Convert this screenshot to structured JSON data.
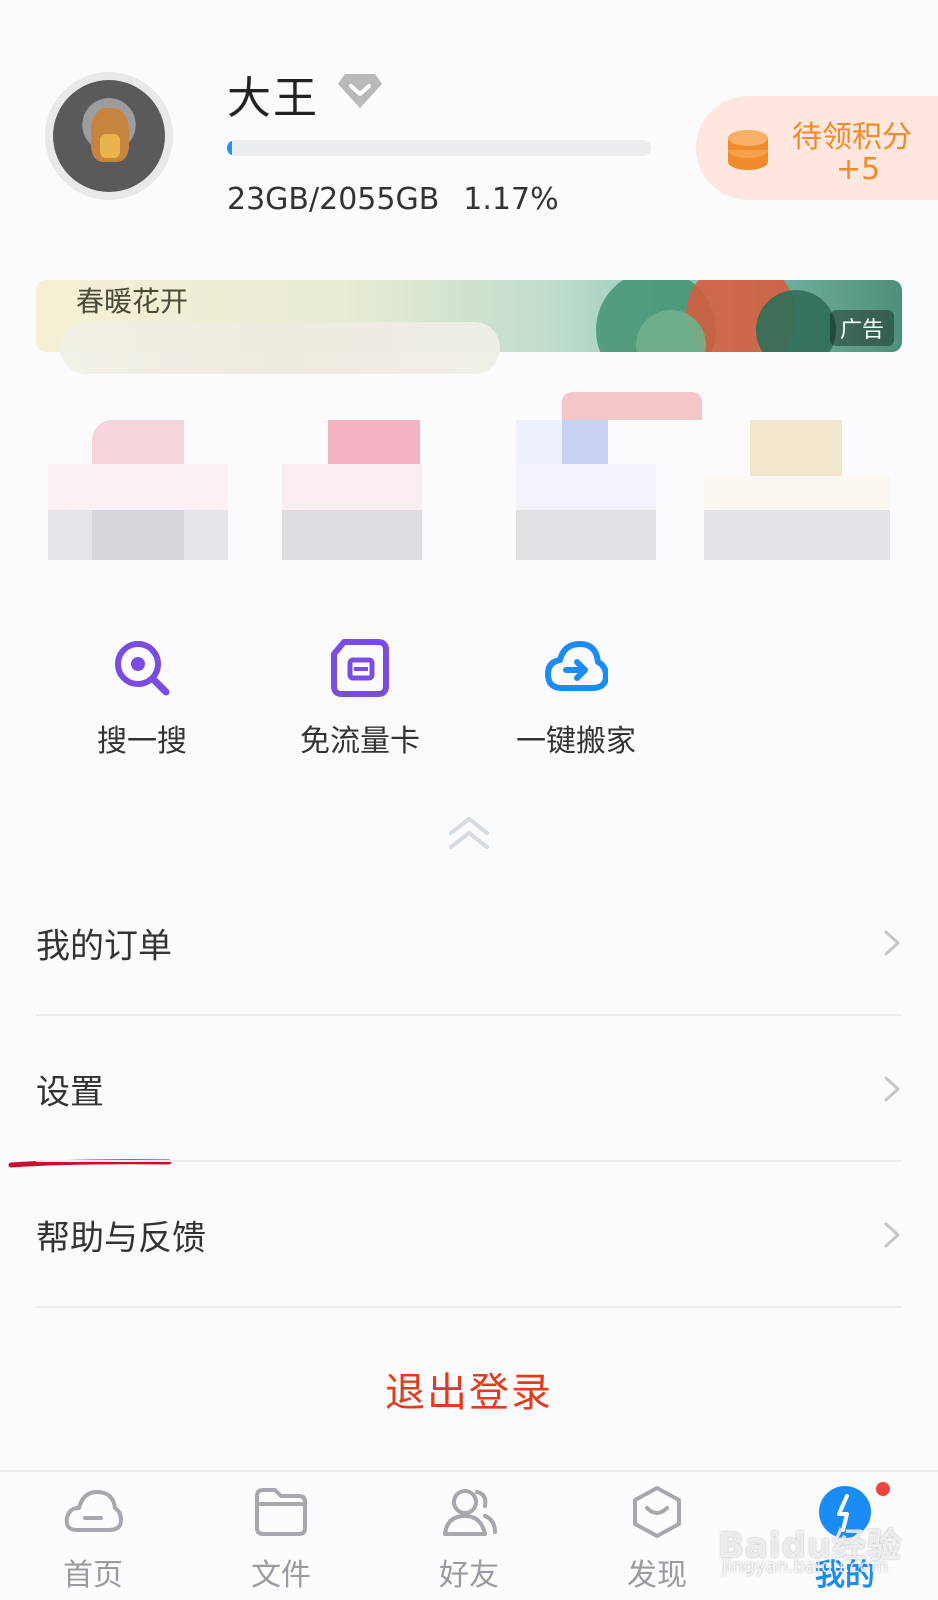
{
  "profile": {
    "name": "大王",
    "storage_used": "23GB/2055GB",
    "storage_percent": "1.17%",
    "storage_fraction": 0.0117
  },
  "points": {
    "label": "待领积分",
    "value": "+5"
  },
  "banner": {
    "text": "春暖花开",
    "badge": "广告"
  },
  "tools": [
    {
      "label": "搜一搜",
      "icon": "search-icon"
    },
    {
      "label": "免流量卡",
      "icon": "sim-card-icon"
    },
    {
      "label": "一键搬家",
      "icon": "cloud-transfer-icon"
    }
  ],
  "menu": [
    {
      "label": "我的订单"
    },
    {
      "label": "设置"
    },
    {
      "label": "帮助与反馈"
    }
  ],
  "logout_label": "退出登录",
  "tabs": [
    {
      "label": "首页",
      "icon": "cloud-home-icon"
    },
    {
      "label": "文件",
      "icon": "folder-icon"
    },
    {
      "label": "好友",
      "icon": "friends-icon"
    },
    {
      "label": "发现",
      "icon": "discover-icon"
    },
    {
      "label": "我的",
      "icon": "me-icon",
      "active": true
    }
  ],
  "watermark": {
    "main": "Baidu经验",
    "sub": "jingyan.baidu.com"
  },
  "colors": {
    "accent": "#1a8cf3",
    "logout": "#e23c1c",
    "points": "#f08a2a",
    "annotation": "#c8102e"
  }
}
